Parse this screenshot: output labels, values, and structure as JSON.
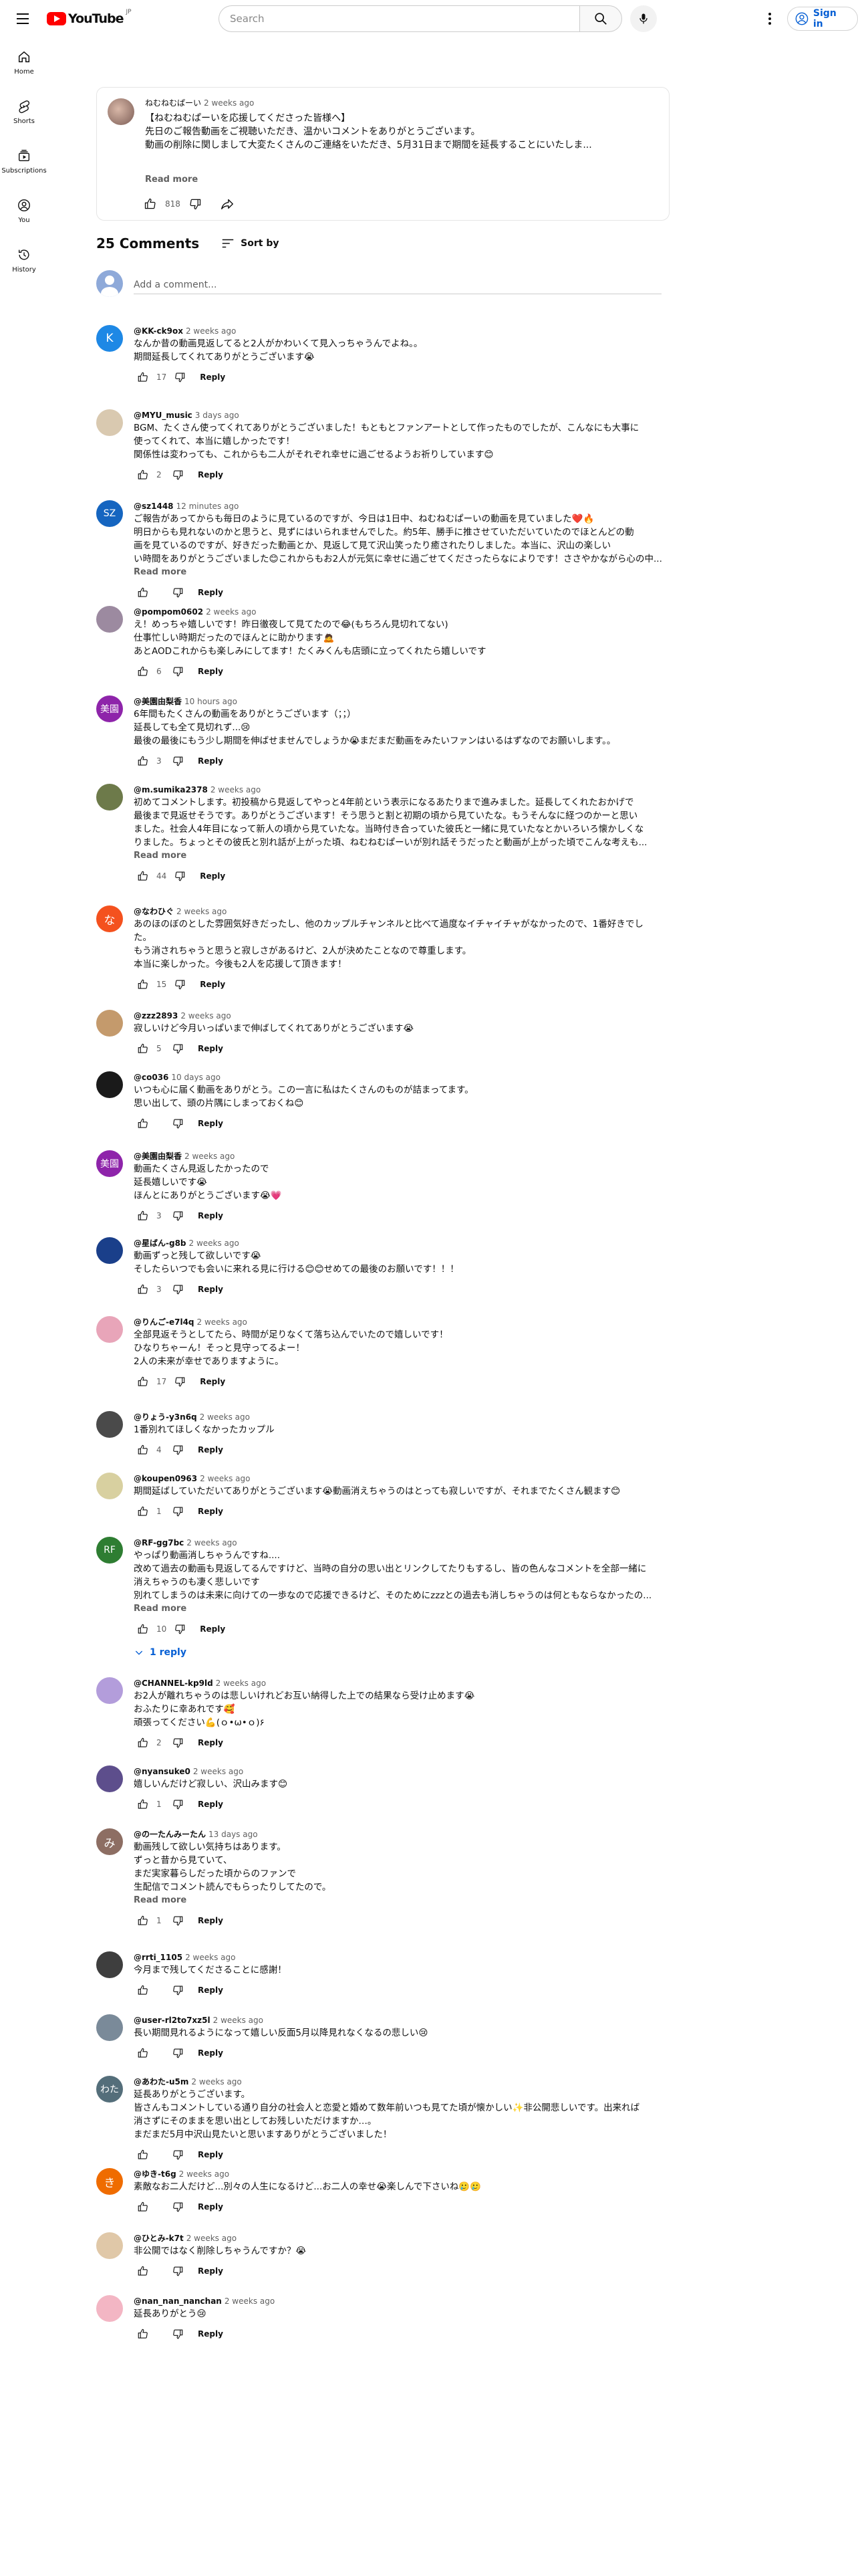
{
  "header": {
    "logo_text": "YouTube",
    "logo_region": "JP",
    "search_placeholder": "Search",
    "signin_label": "Sign in"
  },
  "sidebar": {
    "items": [
      {
        "label": "Home",
        "icon": "home-icon"
      },
      {
        "label": "Shorts",
        "icon": "shorts-icon"
      },
      {
        "label": "Subscriptions",
        "icon": "subscriptions-icon"
      },
      {
        "label": "You",
        "icon": "you-icon"
      },
      {
        "label": "History",
        "icon": "history-icon"
      }
    ]
  },
  "post": {
    "author": "ねむねむぱーい",
    "time": "2 weeks ago",
    "lines": [
      "【ねむねむぱーいを応援してくださった皆様へ】",
      "",
      "先日のご報告動画をご視聴いただき、温かいコメントをありがとうございます。",
      "動画の削除に関しまして大変たくさんのご連絡をいただき、5月31日まで期間を延長することにいたしま..."
    ],
    "read_more": "Read more",
    "likes": "818"
  },
  "comments_header": {
    "count_label": "25 Comments",
    "sort_label": "Sort by"
  },
  "add_comment_placeholder": "Add a comment...",
  "reply_label": "Reply",
  "comments": [
    {
      "author": "@KK-ck9ox",
      "time": "2 weeks ago",
      "avatar_letter": "K",
      "avatar_color": "#1e88e5",
      "likes": "17",
      "lines": [
        "なんか昔の動画見返してると2人がかわいくて見入っちゃうんでよね。。",
        "期間延長してくれてありがとうございます😭"
      ],
      "more": "",
      "replies": ""
    },
    {
      "author": "@MYU_music",
      "time": "3 days ago",
      "avatar_letter": "",
      "avatar_color": "#d9c9b0",
      "likes": "2",
      "lines": [
        "BGM、たくさん使ってくれてありがとうございました！もともとファンアートとして作ったものでしたが、こんなにも大事に",
        "使ってくれて、本当に嬉しかったです！",
        "関係性は変わっても、これからも二人がそれぞれ幸せに過ごせるようお祈りしています😊"
      ],
      "more": "",
      "replies": ""
    },
    {
      "author": "@sz1448",
      "time": "12 minutes ago",
      "avatar_letter": "SZ",
      "avatar_color": "#1565c0",
      "likes": "",
      "lines": [
        "ご報告があってからも毎日のように見ているのですが、今日は1日中、ねむねむぱーいの動画を見ていました❤️🔥",
        "明日からも見れないのかと思うと、見ずにはいられませんでした。約5年、勝手に推させていただいていたのでほとんどの動",
        "画を見ているのですが、好きだった動画とか、見返して見て沢山笑ったり癒されたりしました。本当に、沢山の楽しい",
        "い時間をありがとうございました😊これからもお2人が元気に幸せに過ごせてくださったらなによりです！ささやかながら心の中..."
      ],
      "more": "Read more",
      "replies": ""
    },
    {
      "author": "@pompom0602",
      "time": "2 weeks ago",
      "avatar_letter": "",
      "avatar_color": "#9c8aa0",
      "likes": "6",
      "lines": [
        "え！めっちゃ嬉しいです！昨日徹夜して見てたので😂(もちろん見切れてない)",
        "仕事忙しい時期だったのでほんとに助かります🙇",
        "あとAODこれからも楽しみにしてます！たくみくんも店頭に立ってくれたら嬉しいです"
      ],
      "more": "",
      "replies": ""
    },
    {
      "author": "@美園由梨香",
      "time": "10 hours ago",
      "avatar_letter": "美園",
      "avatar_color": "#8e24aa",
      "likes": "3",
      "lines": [
        "6年間もたくさんの動画をありがとうございます（；；）",
        "延長しても全て見切れず...😢",
        "最後の最後にもう少し期間を伸ばせませんでしょうか😭まだまだ動画をみたいファンはいるはずなのでお願いします。。"
      ],
      "more": "",
      "replies": ""
    },
    {
      "author": "@m.sumika2378",
      "time": "2 weeks ago",
      "avatar_letter": "",
      "avatar_color": "#6d7a4a",
      "likes": "44",
      "lines": [
        "初めてコメントします。初投稿から見返してやっと4年前という表示になるあたりまで進みました。延長してくれたおかげで",
        "最後まで見返せそうです。ありがとうございます！そう思うと割と初期の頃から見ていたな。もうそんなに経つのかーと思い",
        "ました。社会人4年目になって新人の頃から見ていたな。当時付き合っていた彼氏と一緒に見ていたなとかいろいろ懐かしくな",
        "りました。ちょっとその彼氏と別れ話が上がった頃、ねむねむぱーいが別れ話そうだったと動画が上がった頃でこんな考えも..."
      ],
      "more": "Read more",
      "replies": ""
    },
    {
      "author": "@なわひぐ",
      "time": "2 weeks ago",
      "avatar_letter": "な",
      "avatar_color": "#f4511e",
      "likes": "15",
      "lines": [
        "あのほのぼのとした雰囲気好きだったし、他のカップルチャンネルと比べて過度なイチャイチャがなかったので、1番好きでし",
        "た。",
        "もう消されちゃうと思うと寂しさがあるけど、2人が決めたことなので尊重します。",
        "本当に楽しかった。今後も2人を応援して頂きます！"
      ],
      "more": "",
      "replies": ""
    },
    {
      "author": "@zzz2893",
      "time": "2 weeks ago",
      "avatar_letter": "",
      "avatar_color": "#c49a6c",
      "likes": "5",
      "lines": [
        "寂しいけど今月いっぱいまで伸ばしてくれてありがとうございます😭"
      ],
      "more": "",
      "replies": ""
    },
    {
      "author": "@co036",
      "time": "10 days ago",
      "avatar_letter": "",
      "avatar_color": "#1a1a1a",
      "likes": "",
      "lines": [
        "いつも心に届く動画をありがとう。この一言に私はたくさんのものが詰まってます。",
        "思い出して、頭の片隅にしまっておくね😊"
      ],
      "more": "",
      "replies": ""
    },
    {
      "author": "@美園由梨香",
      "time": "2 weeks ago",
      "avatar_letter": "美園",
      "avatar_color": "#8e24aa",
      "likes": "3",
      "lines": [
        "動画たくさん見返したかったので",
        "延長嬉しいです😭",
        "ほんとにありがとうございます😭💗"
      ],
      "more": "",
      "replies": ""
    },
    {
      "author": "@星ばん-g8b",
      "time": "2 weeks ago",
      "avatar_letter": "",
      "avatar_color": "#1a3f8a",
      "likes": "3",
      "lines": [
        "動画ずっと残して欲しいです😭",
        "そしたらいつでも会いに来れる見に行ける😊😊せめての最後のお願いです！！！"
      ],
      "more": "",
      "replies": ""
    },
    {
      "author": "@りんご-e7l4q",
      "time": "2 weeks ago",
      "avatar_letter": "",
      "avatar_color": "#e8a5b9",
      "likes": "17",
      "lines": [
        "全部見返そうとしてたら、時間が足りなくて落ち込んでいたので嬉しいです！",
        "ひなりちゃーん！そっと見守ってるよー！",
        "2人の未来が幸せでありますように。"
      ],
      "more": "",
      "replies": ""
    },
    {
      "author": "@りょう-y3n6q",
      "time": "2 weeks ago",
      "avatar_letter": "",
      "avatar_color": "#4a4a4a",
      "likes": "4",
      "lines": [
        "1番別れてほしくなかったカップル"
      ],
      "more": "",
      "replies": ""
    },
    {
      "author": "@koupen0963",
      "time": "2 weeks ago",
      "avatar_letter": "",
      "avatar_color": "#d8d0a0",
      "likes": "1",
      "lines": [
        "期間延ばしていただいてありがとうございます😭動画消えちゃうのはとっても寂しいですが、それまでたくさん観ます😊"
      ],
      "more": "",
      "replies": ""
    },
    {
      "author": "@RF-gg7bc",
      "time": "2 weeks ago",
      "avatar_letter": "RF",
      "avatar_color": "#2e7d32",
      "likes": "10",
      "lines": [
        "やっぱり動画消しちゃうんですね....",
        "改めて過去の動画も見返してるんですけど、当時の自分の思い出とリンクしてたりもするし、皆の色んなコメントを全部一緒に",
        "消えちゃうのも凄く悲しいです",
        "別れてしまうのは未来に向けての一歩なので応援できるけど、そのためにzzzとの過去も消しちゃうのは何ともならなかったの..."
      ],
      "more": "Read more",
      "replies": "1 reply"
    },
    {
      "author": "@CHANNEL-kp9ld",
      "time": "2 weeks ago",
      "avatar_letter": "",
      "avatar_color": "#b39ddb",
      "likes": "2",
      "lines": [
        "お2人が離れちゃうのは悲しいけれどお互い納得した上での結果なら受け止めます😭",
        "おふたりに幸あれです🥰",
        "頑張ってください💪(ｏ•ω•ｏ)۶"
      ],
      "more": "",
      "replies": ""
    },
    {
      "author": "@nyansuke0",
      "time": "2 weeks ago",
      "avatar_letter": "",
      "avatar_color": "#5d4e8c",
      "likes": "1",
      "lines": [
        "嬉しいんだけど寂しい、沢山みます😊"
      ],
      "more": "",
      "replies": ""
    },
    {
      "author": "@の一たんみーたん",
      "time": "13 days ago",
      "avatar_letter": "み",
      "avatar_color": "#8d6e63",
      "likes": "1",
      "lines": [
        "動画残して欲しい気持ちはあります。",
        "ずっと昔から見ていて、",
        "まだ実家暮らしだった頃からのファンで",
        "生配信でコメント読んでもらったりしてたので。"
      ],
      "more": "Read more",
      "replies": ""
    },
    {
      "author": "@rrti_1105",
      "time": "2 weeks ago",
      "avatar_letter": "",
      "avatar_color": "#3e3e3e",
      "likes": "",
      "lines": [
        "今月まで残してくださることに感謝！"
      ],
      "more": "",
      "replies": ""
    },
    {
      "author": "@user-rl2to7xz5l",
      "time": "2 weeks ago",
      "avatar_letter": "",
      "avatar_color": "#7a8a99",
      "likes": "",
      "lines": [
        "長い期間見れるようになって嬉しい反面5月以降見れなくなるの悲しい😢"
      ],
      "more": "",
      "replies": ""
    },
    {
      "author": "@あわた-u5m",
      "time": "2 weeks ago",
      "avatar_letter": "わた",
      "avatar_color": "#546e7a",
      "likes": "",
      "lines": [
        "延長ありがとうございます。",
        "皆さんもコメントしている通り自分の社会人と恋愛と婚めて数年前いつも見てた頃が懐かしい✨非公開悲しいです。出来れば",
        "消さずにそのままを思い出としてお残しいただけますか…。",
        "まだまだ5月中沢山見たいと思いますありがとうございました！"
      ],
      "more": "",
      "replies": ""
    },
    {
      "author": "@ゆき-t6g",
      "time": "2 weeks ago",
      "avatar_letter": "き",
      "avatar_color": "#ef6c00",
      "likes": "",
      "lines": [
        "素敵なお二人だけど...別々の人生になるけど...お二人の幸せ😭楽しんで下さいね🥲🥲"
      ],
      "more": "",
      "replies": ""
    },
    {
      "author": "@ひとみ-k7t",
      "time": "2 weeks ago",
      "avatar_letter": "",
      "avatar_color": "#e0c8a8",
      "likes": "",
      "lines": [
        "非公開ではなく削除しちゃうんですか？😭"
      ],
      "more": "",
      "replies": ""
    },
    {
      "author": "@nan_nan_nanchan",
      "time": "2 weeks ago",
      "avatar_letter": "",
      "avatar_color": "#f3b6c4",
      "likes": "",
      "lines": [
        "延長ありがとう😢"
      ],
      "more": "",
      "replies": ""
    }
  ]
}
